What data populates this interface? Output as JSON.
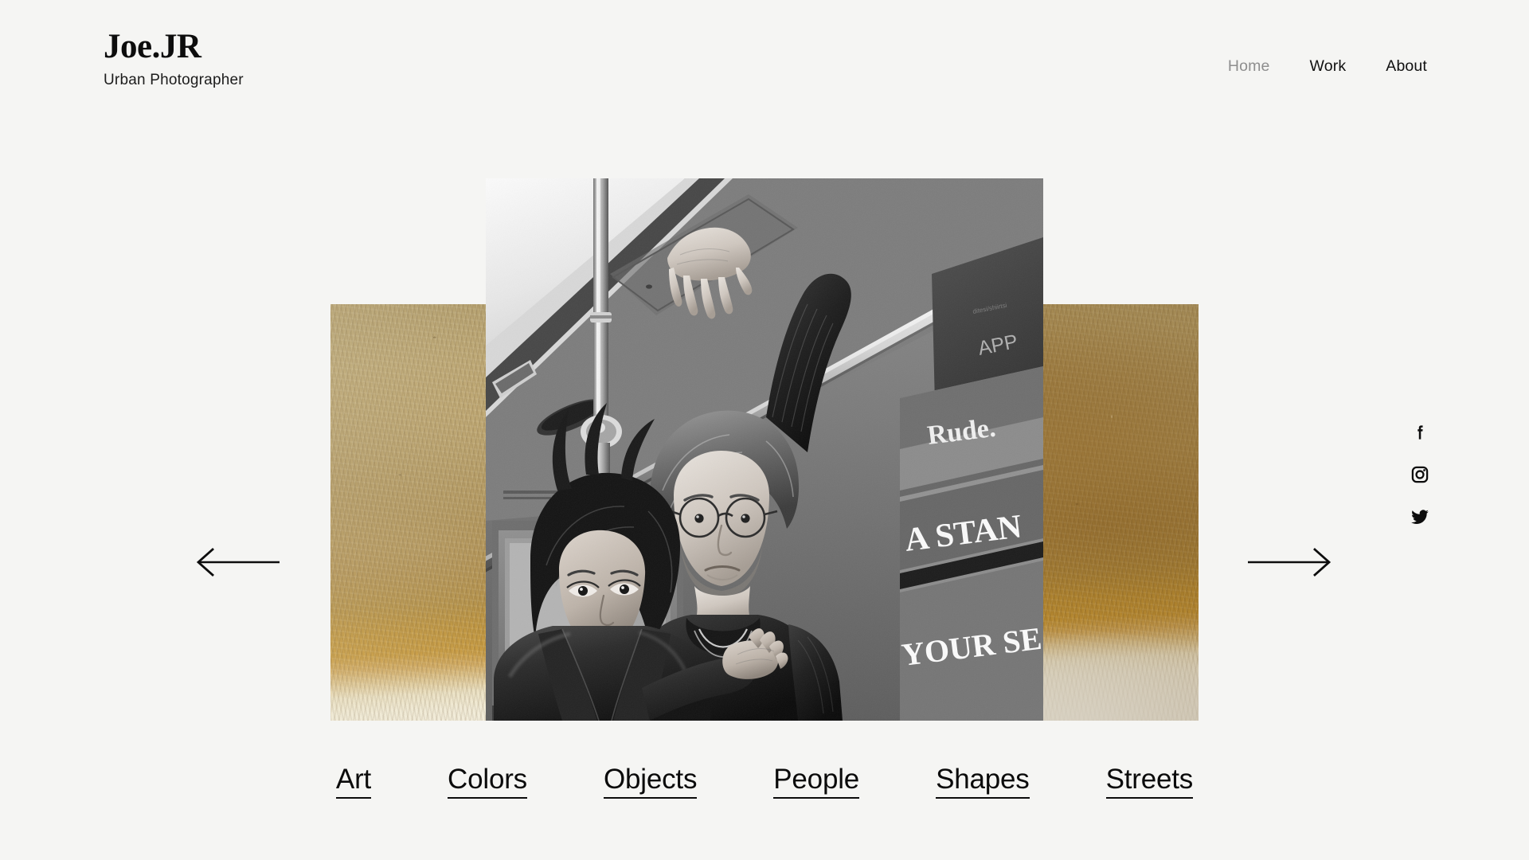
{
  "site": {
    "background_color": "#f5f5f3",
    "text_color": "#0d0d0d"
  },
  "header": {
    "brand_name": "Joe.JR",
    "brand_tagline": "Urban Photographer",
    "nav": [
      {
        "label": "Home",
        "state": "muted",
        "color": "#8e8e8e"
      },
      {
        "label": "Work",
        "state": "normal",
        "color": "#111111"
      },
      {
        "label": "About",
        "state": "normal",
        "color": "#111111"
      }
    ]
  },
  "hero": {
    "prev_arrow_name": "arrow-left-icon",
    "next_arrow_name": "arrow-right-icon",
    "texture": {
      "description": "Gold ochre textured wall panel fading to cream at the bottom",
      "top_color": "#b09a66",
      "mid_color": "#c49434",
      "bottom_color": "#f2efe4"
    },
    "photo": {
      "alt": "Black and white photograph of a couple holding an overhead rail inside a subway car",
      "ad_text_1": "Rude.",
      "ad_text_2": "A STAND",
      "ad_text_3": "YOUR SE",
      "ad_text_4": "APP"
    }
  },
  "social": [
    {
      "network": "Facebook",
      "icon": "facebook-icon"
    },
    {
      "network": "Instagram",
      "icon": "instagram-icon"
    },
    {
      "network": "Twitter",
      "icon": "twitter-icon"
    }
  ],
  "categories": [
    {
      "label": "Art"
    },
    {
      "label": "Colors"
    },
    {
      "label": "Objects"
    },
    {
      "label": "People"
    },
    {
      "label": "Shapes"
    },
    {
      "label": "Streets"
    }
  ]
}
